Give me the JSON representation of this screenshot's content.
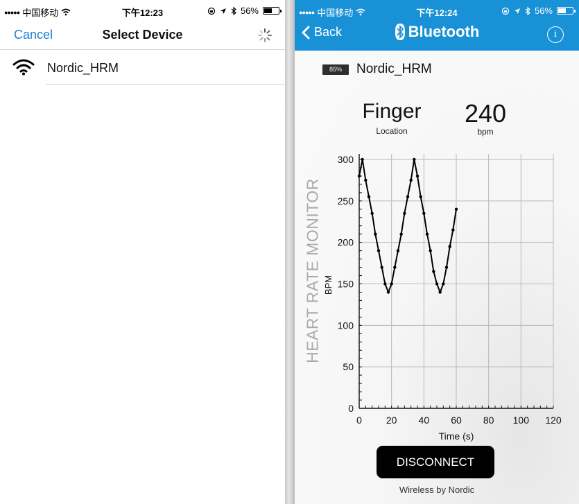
{
  "left_screen": {
    "status": {
      "carrier": "中国移动",
      "time": "下午12:23",
      "battery": "56%"
    },
    "nav": {
      "cancel_label": "Cancel",
      "title": "Select Device"
    },
    "devices": [
      {
        "name": "Nordic_HRM",
        "icon": "wifi-signal-icon"
      }
    ]
  },
  "right_screen": {
    "status": {
      "carrier": "中国移动",
      "time": "下午12:24",
      "battery": "56%"
    },
    "nav": {
      "back_label": "Back",
      "title": "Bluetooth",
      "info_label": "i"
    },
    "device": {
      "battery_badge": "85%",
      "name": "Nordic_HRM"
    },
    "sensor_location": {
      "value": "Finger",
      "label": "Location"
    },
    "heart_rate": {
      "value": "240",
      "label": "bpm"
    },
    "side_title": "HEART RATE MONITOR",
    "disconnect_label": "DISCONNECT",
    "footer": "Wireless by Nordic"
  },
  "colors": {
    "accent_blue": "#1891d6",
    "ios_blue": "#1a7fd6",
    "button_black": "#000000"
  },
  "chart_data": {
    "type": "line",
    "xlabel": "Time (s)",
    "ylabel": "BPM",
    "xlim": [
      0,
      120
    ],
    "ylim": [
      0,
      300
    ],
    "xticks": [
      0,
      20,
      40,
      60,
      80,
      100,
      120
    ],
    "yticks": [
      0,
      50,
      100,
      150,
      200,
      250,
      300
    ],
    "grid": true,
    "series": [
      {
        "x": [
          0,
          2,
          4,
          6,
          8,
          10,
          12,
          14,
          16,
          18,
          20,
          22,
          24,
          26,
          28,
          30,
          32,
          34,
          36,
          38,
          40,
          42,
          44,
          46,
          48,
          50,
          52,
          54,
          56,
          58,
          60
        ],
        "values": [
          280,
          300,
          275,
          255,
          235,
          210,
          190,
          170,
          150,
          140,
          150,
          170,
          190,
          210,
          235,
          255,
          275,
          300,
          280,
          255,
          235,
          210,
          190,
          165,
          150,
          140,
          150,
          170,
          195,
          215,
          240
        ]
      }
    ]
  }
}
